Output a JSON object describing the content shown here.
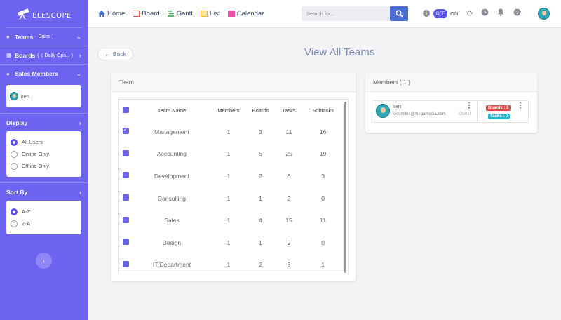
{
  "app": {
    "logo_text": "ELESCOPE"
  },
  "sidebar": {
    "teams": {
      "label": "Teams",
      "sub": "( Sales          )"
    },
    "boards": {
      "label": "Boards",
      "sub": "( ☇ Daily Ops... )"
    },
    "members": {
      "label": "Sales Members",
      "items": [
        {
          "name": "ken"
        }
      ]
    },
    "display": {
      "title": "Display",
      "options": [
        "All Users",
        "Online Only",
        "Offline Only"
      ],
      "selected": "All Users"
    },
    "sort": {
      "title": "Sort By",
      "options": [
        "A-Z",
        "Z-A"
      ],
      "selected": "A-Z"
    }
  },
  "topnav": {
    "items": [
      {
        "label": "Home",
        "color": "#3d6fd6"
      },
      {
        "label": "Board",
        "color": "#d9534f"
      },
      {
        "label": "Gantt",
        "color": "#3fa34d"
      },
      {
        "label": "List",
        "color": "#f0b429"
      },
      {
        "label": "Calendar",
        "color": "#e64fa8"
      }
    ],
    "search_placeholder": "Search for...",
    "toggle_off": "OFF",
    "toggle_on": "ON"
  },
  "page": {
    "title": "View All Teams",
    "back_label": "Back"
  },
  "team_card": {
    "title": "Team",
    "columns": [
      "Team Name",
      "Members",
      "Boards",
      "Tasks",
      "Subtasks"
    ],
    "rows": [
      {
        "name": "Management",
        "members": "1",
        "boards": "3",
        "tasks": "11",
        "subtasks": "16",
        "checked": true
      },
      {
        "name": "Accounting",
        "members": "1",
        "boards": "5",
        "tasks": "25",
        "subtasks": "19",
        "checked": false
      },
      {
        "name": "Development",
        "members": "1",
        "boards": "2",
        "tasks": "6",
        "subtasks": "3",
        "checked": false
      },
      {
        "name": "Consulting",
        "members": "1",
        "boards": "1",
        "tasks": "2",
        "subtasks": "0",
        "checked": false
      },
      {
        "name": "Sales",
        "members": "1",
        "boards": "4",
        "tasks": "15",
        "subtasks": "11",
        "checked": false
      },
      {
        "name": "Design",
        "members": "1",
        "boards": "1",
        "tasks": "2",
        "subtasks": "0",
        "checked": false
      },
      {
        "name": "IT Department",
        "members": "1",
        "boards": "2",
        "tasks": "3",
        "subtasks": "1",
        "checked": false
      }
    ]
  },
  "members_card": {
    "title": "Members ( 1 )",
    "member": {
      "name": "ken",
      "email": "ken.miles@megamedia.com",
      "role": "Owner",
      "boards_badge": "Boards : 3",
      "tasks_badge": "Tasks : 0"
    }
  }
}
